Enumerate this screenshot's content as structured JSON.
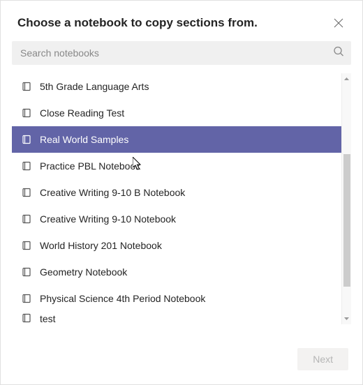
{
  "header": {
    "title": "Choose a notebook to copy sections from."
  },
  "search": {
    "placeholder": "Search notebooks"
  },
  "notebooks": [
    {
      "label": "5th Grade Language Arts",
      "selected": false
    },
    {
      "label": "Close Reading Test",
      "selected": false
    },
    {
      "label": "Real World Samples",
      "selected": true
    },
    {
      "label": "Practice PBL Notebook",
      "selected": false
    },
    {
      "label": "Creative Writing 9-10 B Notebook",
      "selected": false
    },
    {
      "label": "Creative Writing 9-10 Notebook",
      "selected": false
    },
    {
      "label": "World History 201 Notebook",
      "selected": false
    },
    {
      "label": "Geometry Notebook",
      "selected": false
    },
    {
      "label": "Physical Science 4th Period Notebook",
      "selected": false
    },
    {
      "label": "test",
      "selected": false
    }
  ],
  "footer": {
    "next_label": "Next"
  }
}
